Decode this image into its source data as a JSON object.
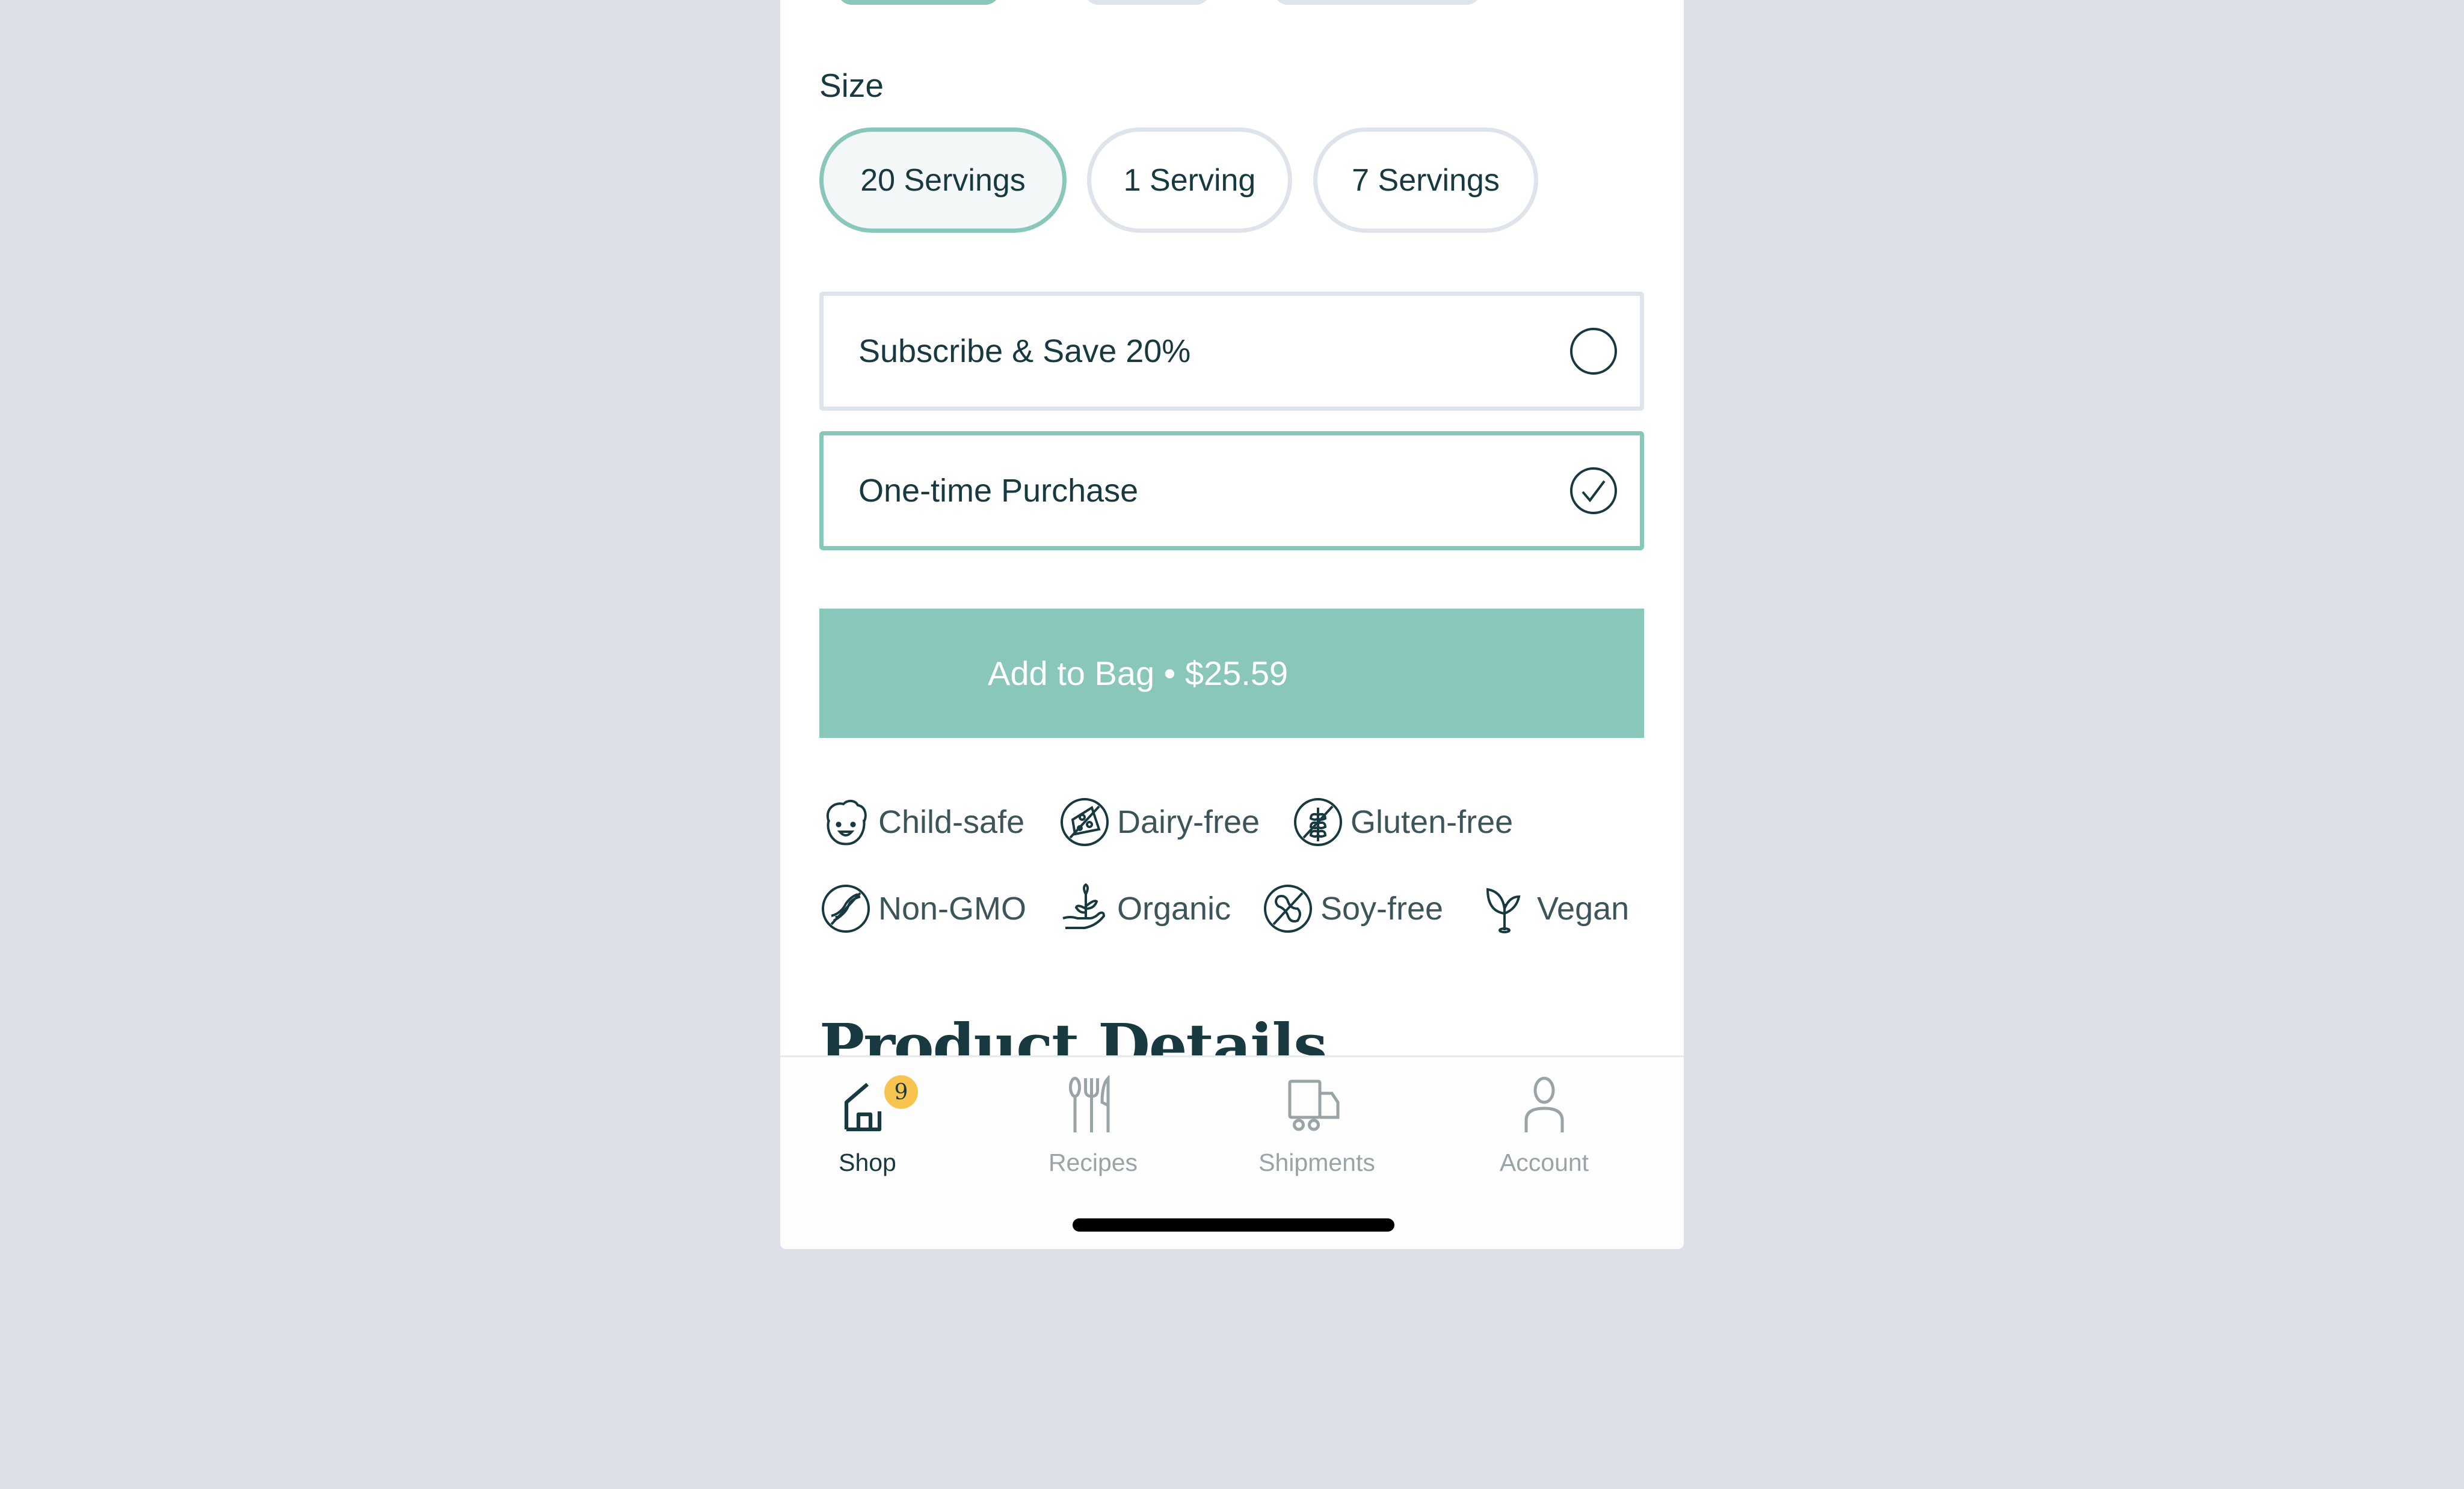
{
  "size": {
    "label": "Size",
    "options": [
      {
        "label": "20 Servings",
        "selected": true
      },
      {
        "label": "1 Serving",
        "selected": false
      },
      {
        "label": "7 Servings",
        "selected": false
      }
    ]
  },
  "purchase_options": [
    {
      "label": "Subscribe & Save 20%",
      "selected": false
    },
    {
      "label": "One-time Purchase",
      "selected": true
    }
  ],
  "add_to_bag": {
    "label": "Add to Bag • $25.59",
    "price": "$25.59"
  },
  "attributes": [
    {
      "label": "Child-safe",
      "icon": "child-face-icon"
    },
    {
      "label": "Dairy-free",
      "icon": "no-dairy-icon"
    },
    {
      "label": "Gluten-free",
      "icon": "no-gluten-icon"
    },
    {
      "label": "Non-GMO",
      "icon": "no-gmo-icon"
    },
    {
      "label": "Organic",
      "icon": "organic-hand-sprout-icon"
    },
    {
      "label": "Soy-free",
      "icon": "no-soy-icon"
    },
    {
      "label": "Vegan",
      "icon": "sprout-icon"
    }
  ],
  "product_details": {
    "heading": "Product Details"
  },
  "tabbar": {
    "tabs": [
      {
        "label": "Shop",
        "icon": "shop-house-icon",
        "active": true,
        "badge": "9"
      },
      {
        "label": "Recipes",
        "icon": "utensils-icon",
        "active": false
      },
      {
        "label": "Shipments",
        "icon": "truck-icon",
        "active": false
      },
      {
        "label": "Account",
        "icon": "person-icon",
        "active": false
      }
    ]
  },
  "colors": {
    "accent": "#89c7bb",
    "text": "#17393f",
    "muted": "#9aa3a5",
    "badge": "#f8c450",
    "background": "#dde0e8"
  }
}
